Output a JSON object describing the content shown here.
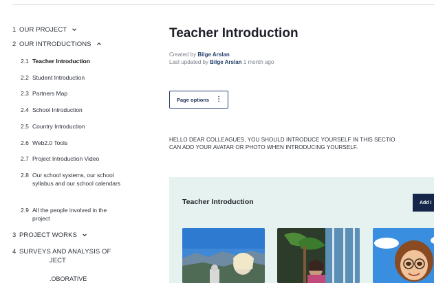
{
  "sidebar": {
    "items": [
      {
        "num": "1",
        "label": "OUR PROJECT",
        "chevron": "down"
      },
      {
        "num": "2",
        "label": "OUR INTRODUCTIONS",
        "chevron": "up"
      },
      {
        "num": "2.1",
        "label": "Teacher Introduction",
        "active": true
      },
      {
        "num": "2.2",
        "label": "Student Introduction"
      },
      {
        "num": "2.3",
        "label": "Partners Map"
      },
      {
        "num": "2.4",
        "label": "School Introduction"
      },
      {
        "num": "2.5",
        "label": "Country Introduction"
      },
      {
        "num": "2.6",
        "label": "Web2.0 Tools"
      },
      {
        "num": "2.7",
        "label": "Project Introduction Video"
      },
      {
        "num": "2.8",
        "label": "Our school systems, our school syllabus and our school calendars"
      },
      {
        "num": "2.9",
        "label": "All the people involved in the project"
      },
      {
        "num": "3",
        "label": "PROJECT WORKS",
        "chevron": "down"
      },
      {
        "num": "4",
        "label": "SURVEYS AND ANALYSIS OF",
        "line2": "JECT"
      },
      {
        "num": "",
        "label": ".OBORATIVE"
      }
    ]
  },
  "page": {
    "title": "Teacher Introduction",
    "created_prefix": "Created by",
    "created_by": "Bilge Arslan",
    "updated_prefix": "Last updated by",
    "updated_by": "Bilge Arslan",
    "updated_when": "1 month ago",
    "page_options_label": "Page options",
    "body_line1": "HELLO DEAR COLLEAGUES, YOU SHOULD INTRODUCE YOURSELF IN THIS SECTIO",
    "body_line2": "CAN ADD YOUR AVATAR OR PHOTO WHEN INTRODUCING YOURSELF."
  },
  "panel": {
    "title": "Teacher Introduction",
    "add_label": "Add I"
  },
  "colors": {
    "accent_navy": "#15264a",
    "panel_bg": "#e6f2ef",
    "link_blue": "#25406b"
  },
  "icons": {
    "chevron_down": "chevron-down-icon",
    "chevron_up": "chevron-up-icon",
    "kebab": "more-options-icon"
  }
}
